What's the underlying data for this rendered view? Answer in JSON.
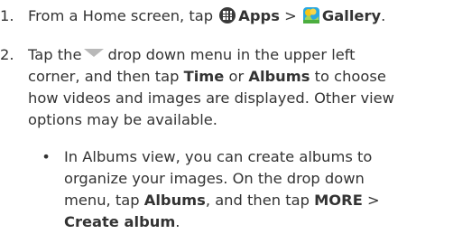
{
  "step1": {
    "number": "1.",
    "text_a": "From a Home screen, tap",
    "apps_label": "Apps",
    "separator": ">",
    "gallery_label": "Gallery",
    "end": "."
  },
  "step2": {
    "number": "2.",
    "line1_a": "Tap the",
    "line1_b": "drop down menu in the upper left",
    "line2_a": "corner, and then tap",
    "time_label": "Time",
    "or": "or",
    "albums_label": "Albums",
    "line2_b": "to choose",
    "line3": "how videos and images are displayed. Other view",
    "line4": "options may be available."
  },
  "bullet": {
    "dot": "•",
    "line1": "In Albums view, you can create albums to",
    "line2": "organize your images. On the drop down",
    "line3_a": "menu, tap",
    "albums_label": "Albums",
    "line3_b": ", and then tap",
    "more_label": "MORE",
    "separator": ">",
    "create_label": "Create album",
    "end": "."
  },
  "icons": {
    "apps": "apps-grid-icon",
    "gallery": "gallery-flower-icon",
    "dropdown": "dropdown-triangle-icon"
  },
  "colors": {
    "text": "#333333",
    "apps_icon_bg": "#3a3a3a",
    "dropdown_triangle": "#b9b9b9",
    "gallery_yellow": "#f5c518",
    "gallery_blue": "#29a8e0"
  }
}
